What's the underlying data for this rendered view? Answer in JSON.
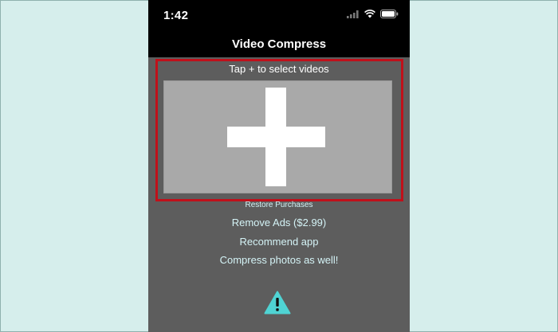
{
  "status_bar": {
    "time": "1:42"
  },
  "nav": {
    "title": "Video Compress"
  },
  "picker": {
    "prompt": "Tap + to select videos"
  },
  "links": {
    "restore": "Restore Purchases",
    "remove_ads": "Remove Ads ($2.99)",
    "recommend": "Recommend app",
    "compress_photos": "Compress photos as well!"
  },
  "icons": {
    "signal": "cellular-signal-icon",
    "wifi": "wifi-icon",
    "battery": "battery-icon",
    "add": "plus-icon",
    "warning": "warning-icon"
  },
  "colors": {
    "accent_link": "#d4f3f6",
    "highlight_border": "#c0101a",
    "warning": "#4fd3d3"
  }
}
